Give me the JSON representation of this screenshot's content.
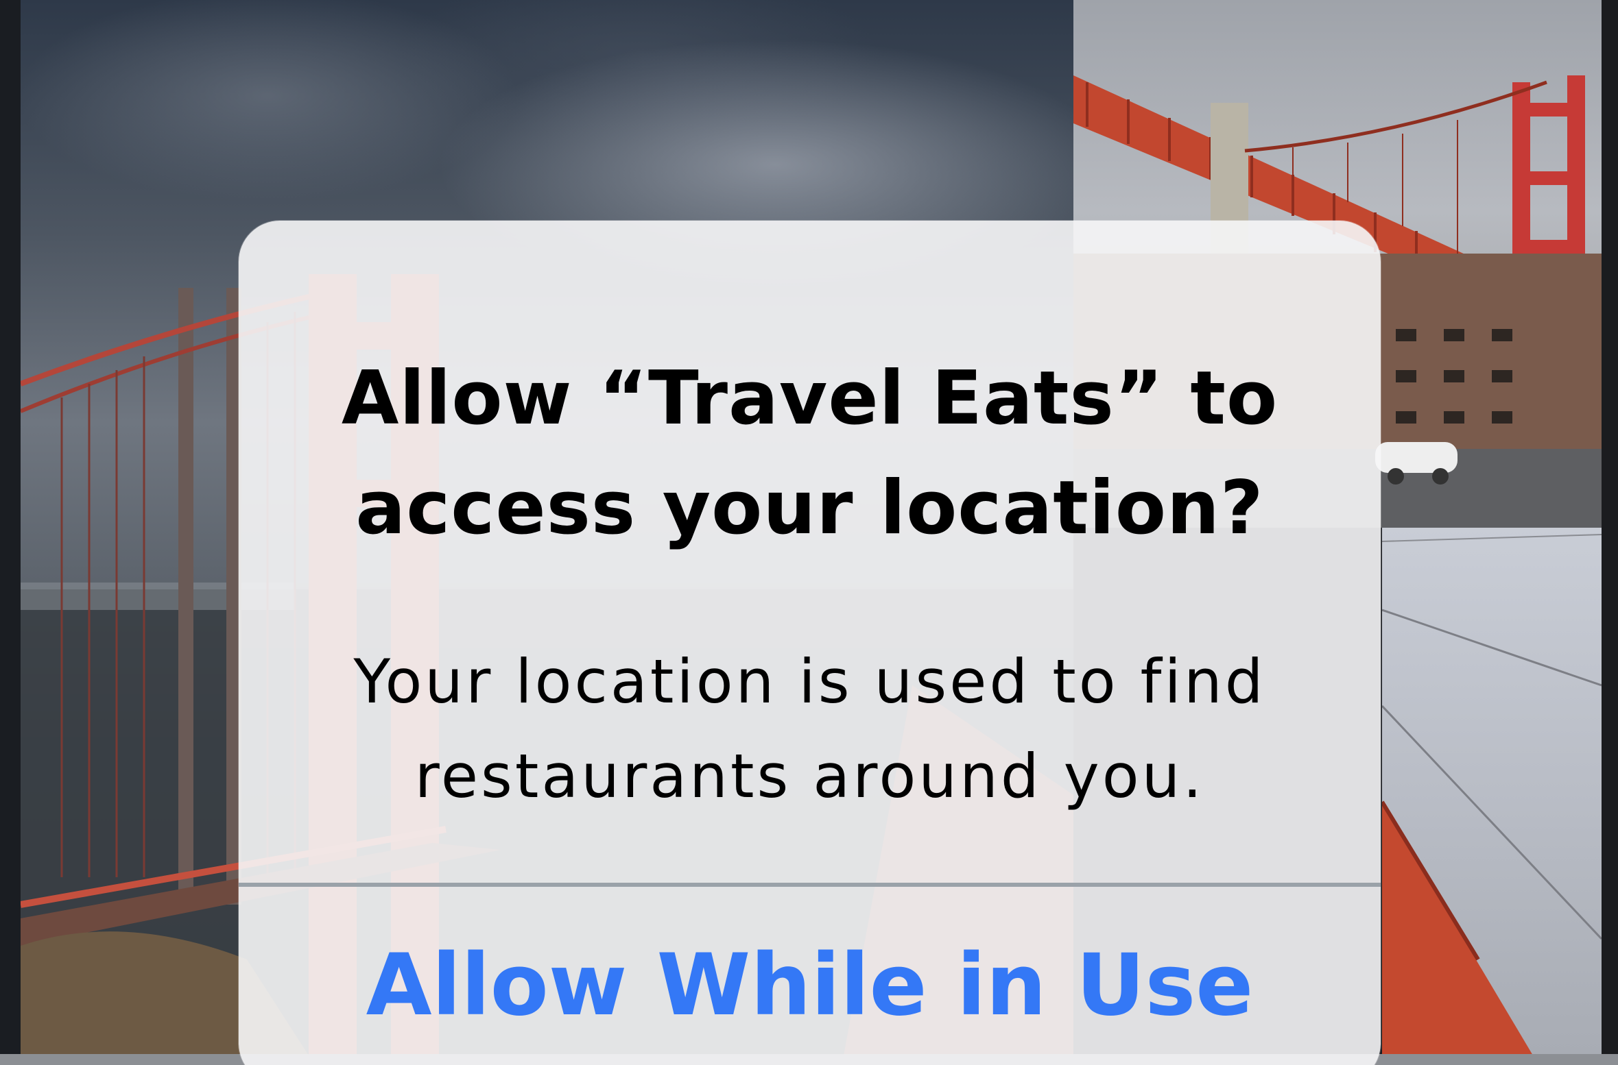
{
  "alert": {
    "title": "Allow “Travel Eats” to\naccess your location?",
    "message": "Your location is used to find\nrestaurants around you.",
    "primary_button_label": "Allow While in Use"
  },
  "colors": {
    "button_text": "#3478f6",
    "alert_background": "#f6f6f7",
    "divider": "#9aa2a9",
    "bridge_red": "#c0402e"
  }
}
